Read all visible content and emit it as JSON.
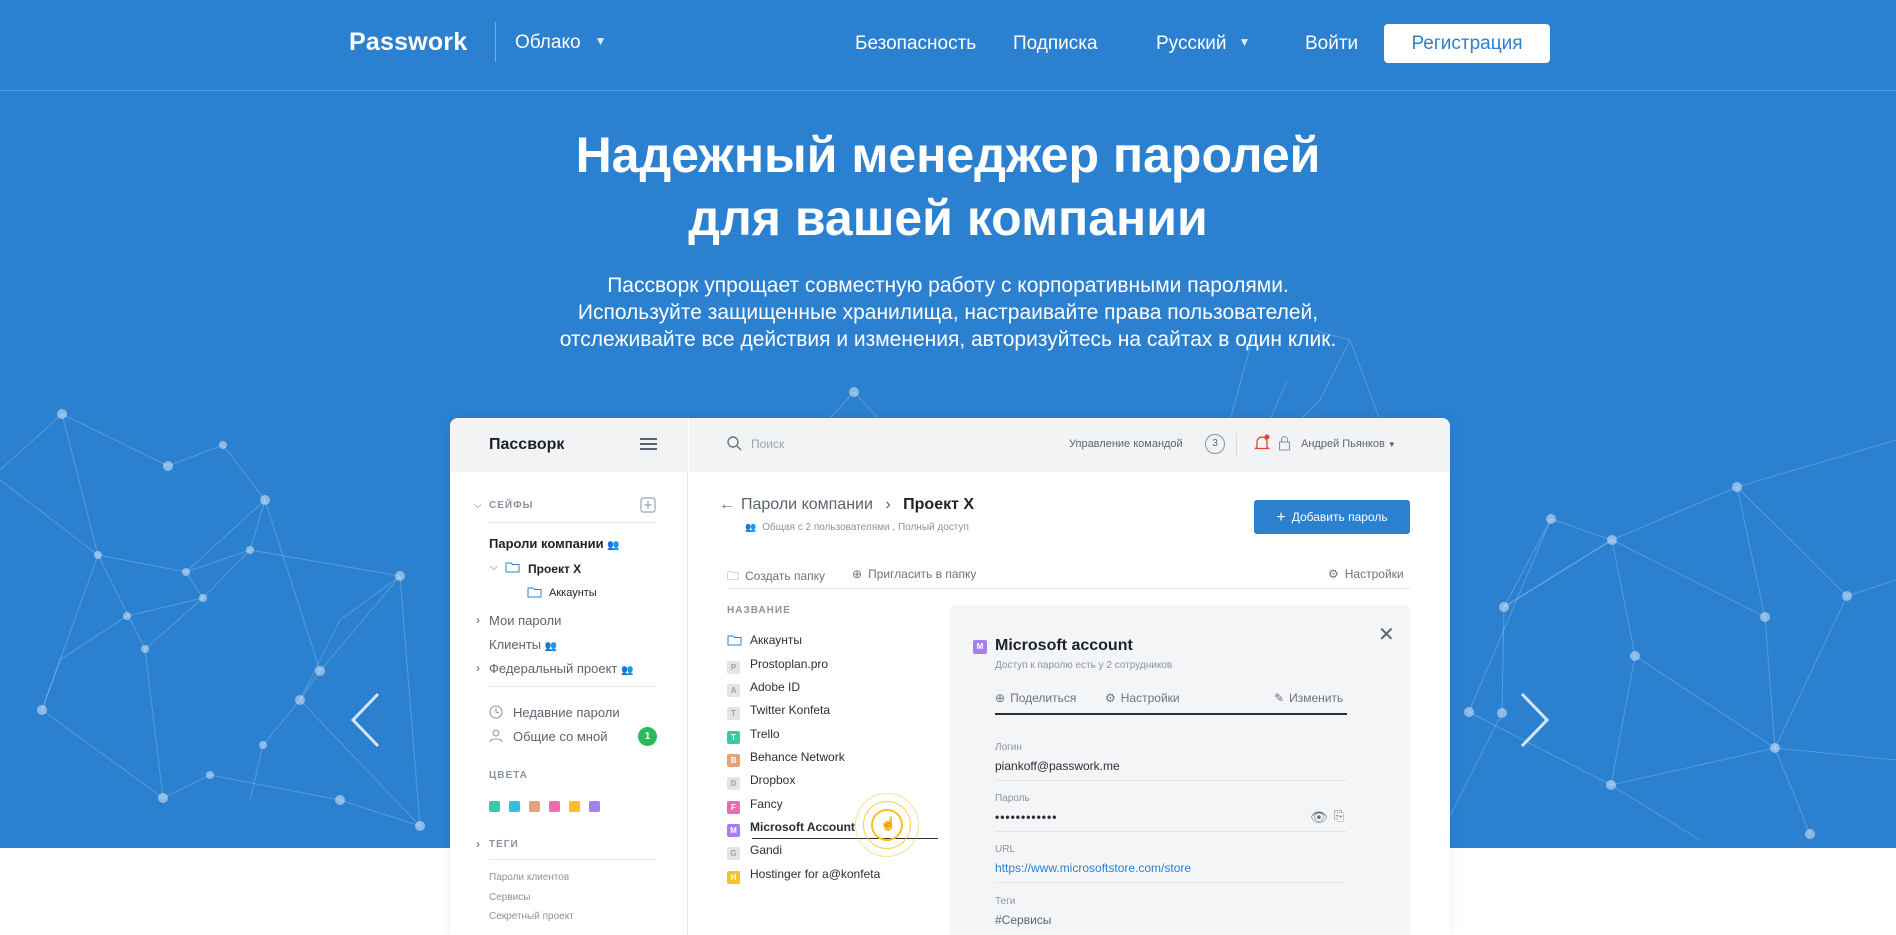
{
  "header": {
    "logo": "Passwork",
    "edition_label": "Облако",
    "nav": {
      "security": "Безопасность",
      "subscription": "Подписка",
      "language": "Русский",
      "login": "Войти",
      "register": "Регистрация"
    }
  },
  "hero": {
    "title_line1": "Надежный менеджер паролей",
    "title_line2": "для вашей компании",
    "subtitle_line1": "Пассворк упрощает совместную работу с корпоративными паролями.",
    "subtitle_line2": "Используйте защищенные хранилища, настраивайте права пользователей,",
    "subtitle_line3": "отслеживайте все действия и изменения, авторизуйтесь на сайтах в один клик."
  },
  "app": {
    "brand": "Пассворк",
    "search_placeholder": "Поиск",
    "team_management": "Управление командой",
    "team_count": "3",
    "user_name": "Андрей Пьянков",
    "sidebar": {
      "safes_label": "СЕЙФЫ",
      "company_passwords": "Пароли компании",
      "project_x": "Проект X",
      "accounts": "Аккаунты",
      "my_passwords": "Мои пароли",
      "clients": "Клиенты",
      "federal_project": "Федеральный проект",
      "recent": "Недавние пароли",
      "shared": "Общие со мной",
      "shared_count": "1",
      "colors_label": "ЦВЕТА",
      "colors": [
        "#3cc7a6",
        "#35bde3",
        "#e3a27a",
        "#f06ab0",
        "#f5c02c",
        "#a57ef0"
      ],
      "tags_label": "ТЕГИ",
      "tags": [
        "Пароли клиентов",
        "Сервисы",
        "Секретный проект"
      ]
    },
    "breadcrumb": {
      "parent": "Пароли компании",
      "current": "Проект X",
      "sub": "Общая с 2 пользователями , Полный доступ"
    },
    "add_button": "Добавить пароль",
    "actions": {
      "create_folder": "Создать папку",
      "invite": "Пригласить в папку",
      "settings": "Настройки"
    },
    "list_header": "НАЗВАНИЕ",
    "items": [
      {
        "name": "Аккаунты",
        "icon": "folder-icon",
        "letter": "",
        "color": "#2b80d0"
      },
      {
        "name": "Prostoplan.pro",
        "letter": "P",
        "color": "#e1e4e8"
      },
      {
        "name": "Adobe ID",
        "letter": "A",
        "color": "#e1e4e8"
      },
      {
        "name": "Twitter Konfeta",
        "letter": "T",
        "color": "#e1e4e8"
      },
      {
        "name": "Trello",
        "letter": "T",
        "color": "#3cc7a6"
      },
      {
        "name": "Behance Network",
        "letter": "B",
        "color": "#e3a27a"
      },
      {
        "name": "Dropbox",
        "letter": "D",
        "color": "#e1e4e8"
      },
      {
        "name": "Fancy",
        "letter": "F",
        "color": "#f06ab0"
      },
      {
        "name": "Microsoft Account",
        "letter": "M",
        "color": "#a57ef0"
      },
      {
        "name": "Gandi",
        "letter": "G",
        "color": "#e1e4e8"
      },
      {
        "name": "Hostinger for a@konfeta",
        "letter": "H",
        "color": "#f5c02c"
      }
    ],
    "detail": {
      "letter": "M",
      "title": "Microsoft account",
      "access": "Доступ к паролю есть у 2 сотрудников",
      "share": "Поделиться",
      "settings": "Настройки",
      "edit": "Изменить",
      "login_label": "Логин",
      "login_value": "piankoff@passwork.me",
      "password_label": "Пароль",
      "password_value": "••••••••••••",
      "url_label": "URL",
      "url_value": "https://www.microsoftstore.com/store",
      "tags_label": "Теги",
      "tags_value": "#Сервисы"
    }
  },
  "colors": {
    "hero_blue": "#2b80d0",
    "white": "#ffffff"
  }
}
